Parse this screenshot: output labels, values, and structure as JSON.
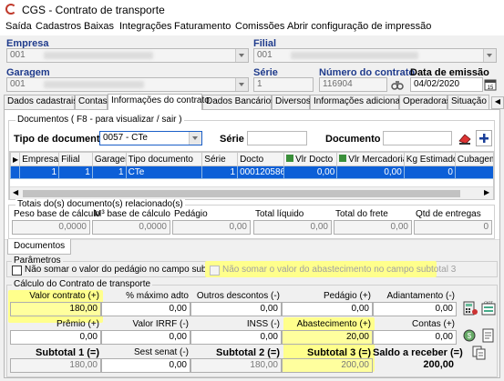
{
  "window": {
    "title": "CGS - Contrato de transporte"
  },
  "menu": [
    "Saída",
    "Cadastros",
    "Baixas",
    "Integrações",
    "Faturamento",
    "Comissões",
    "Abrir configuração de impressão"
  ],
  "header": {
    "empresa_label": "Empresa",
    "empresa_value": "001",
    "filial_label": "Filial",
    "filial_value": "001",
    "garagem_label": "Garagem",
    "garagem_value": "001",
    "serie_label": "Série",
    "serie_value": "1",
    "numero_label": "Número do contrato",
    "numero_value": "116904",
    "data_label": "Data de emissão",
    "data_value": "04/02/2020"
  },
  "tabs": [
    "Dados cadastrais",
    "Contas",
    "Informações do contrato",
    "Dados Bancários",
    "Diversos",
    "Informações adicionais",
    "Operadoras",
    "Situação"
  ],
  "documentos": {
    "group_title": "Documentos ( F8 - para visualizar / sair )",
    "tipo_label": "Tipo de documento",
    "tipo_value": "0057 - CTe",
    "serie_label": "Série",
    "serie_value": "",
    "documento_label": "Documento",
    "documento_value": "",
    "columns": [
      "Empresa",
      "Filial",
      "Garagem",
      "Tipo documento",
      "Série",
      "Docto",
      "Vlr Docto",
      "Vlr Mercadoria",
      "Kg Estimado",
      "Cubagem"
    ],
    "rows": [
      [
        "1",
        "1",
        "1",
        "CTe",
        "1",
        "000120586",
        "0,00",
        "0,00",
        "0",
        "0"
      ]
    ]
  },
  "totais": {
    "title": "Totais do(s) documento(s) relacionado(s)",
    "labels": [
      "Peso base de cálculo",
      "M³ base de cálculo",
      "Pedágio",
      "Total líquido",
      "Total do frete",
      "Qtd de entregas"
    ],
    "values": [
      "0,0000",
      "0,0000",
      "0,00",
      "0,00",
      "0,00",
      "0"
    ]
  },
  "bottom_tab": "Documentos",
  "parametros": {
    "title": "Parâmetros",
    "check1": "Não somar o valor do pedágio no campo subtotal 3",
    "check2": "Não somar o valor do abastecimento no campo subtotal 3"
  },
  "calculo": {
    "title": "Cálculo do Contrato de transporte",
    "row1_labels": [
      "Valor contrato (+)",
      "% máximo adto",
      "Outros descontos (-)",
      "Pedágio (+)",
      "Adiantamento (-)"
    ],
    "row1_values": [
      "180,00",
      "0,00",
      "0,00",
      "0,00",
      "0,00"
    ],
    "row2_labels": [
      "Prêmio (+)",
      "Valor IRRF (-)",
      "INSS (-)",
      "Abastecimento (+)",
      "Contas (+)"
    ],
    "row2_values": [
      "0,00",
      "0,00",
      "0,00",
      "20,00",
      "0,00"
    ],
    "row3_labels": [
      "Subtotal 1 (=)",
      "Sest senat (-)",
      "Subtotal 2 (=)",
      "Subtotal 3 (=)",
      "Saldo a receber (=)"
    ],
    "row3_values": [
      "180,00",
      "0,00",
      "180,00",
      "200,00",
      "200,00"
    ]
  }
}
